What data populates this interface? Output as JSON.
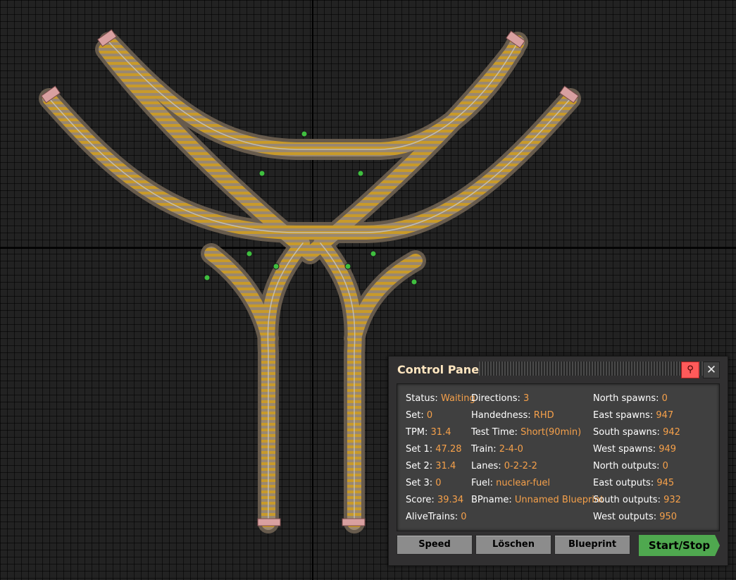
{
  "panel": {
    "title": "Control Panel",
    "col1": [
      {
        "label": "Status:",
        "value": "Waiting"
      },
      {
        "label": "Set:",
        "value": "0"
      },
      {
        "label": "TPM:",
        "value": "31.4"
      },
      {
        "label": "Set 1:",
        "value": "47.28"
      },
      {
        "label": "Set 2:",
        "value": "31.4"
      },
      {
        "label": "Set 3:",
        "value": "0"
      },
      {
        "label": "Score:",
        "value": "39.34"
      },
      {
        "label": "AliveTrains:",
        "value": "0"
      }
    ],
    "col2": [
      {
        "label": "Directions:",
        "value": "3"
      },
      {
        "label": "Handedness:",
        "value": "RHD"
      },
      {
        "label": "Test Time:",
        "value": "Short(90min)"
      },
      {
        "label": "Train:",
        "value": "2-4-0"
      },
      {
        "label": "Lanes:",
        "value": "0-2-2-2"
      },
      {
        "label": "Fuel:",
        "value": "nuclear-fuel"
      },
      {
        "label": "BPname:",
        "value": "Unnamed Blueprint"
      }
    ],
    "col3": [
      {
        "label": "North spawns:",
        "value": "0"
      },
      {
        "label": "East spawns:",
        "value": "947"
      },
      {
        "label": "South spawns:",
        "value": "942"
      },
      {
        "label": "West spawns:",
        "value": "949"
      },
      {
        "label": "North outputs:",
        "value": "0"
      },
      {
        "label": "East outputs:",
        "value": "945"
      },
      {
        "label": "South outputs:",
        "value": "932"
      },
      {
        "label": "West outputs:",
        "value": "950"
      }
    ],
    "buttons": {
      "speed": "Speed",
      "clear": "Löschen",
      "blueprint": "Blueprint",
      "start_stop": "Start/Stop"
    },
    "pin_icon": "pin-icon",
    "close_icon": "close-icon",
    "colors": {
      "value_orange": "#f5a04a",
      "title": "#ffe6c0",
      "start_green": "#4fa84f",
      "pin_red": "#ff5a5a"
    }
  }
}
